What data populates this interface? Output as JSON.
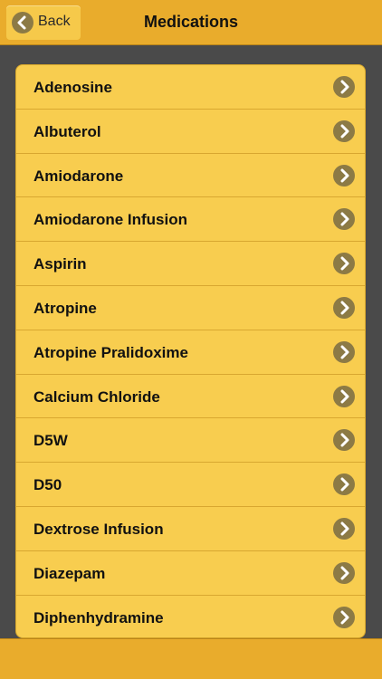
{
  "header": {
    "title": "Medications",
    "back_label": "Back"
  },
  "items": [
    {
      "label": "Adenosine"
    },
    {
      "label": "Albuterol"
    },
    {
      "label": "Amiodarone"
    },
    {
      "label": "Amiodarone Infusion"
    },
    {
      "label": "Aspirin"
    },
    {
      "label": "Atropine"
    },
    {
      "label": "Atropine Pralidoxime"
    },
    {
      "label": "Calcium Chloride"
    },
    {
      "label": "D5W"
    },
    {
      "label": "D50"
    },
    {
      "label": "Dextrose Infusion"
    },
    {
      "label": "Diazepam"
    },
    {
      "label": "Diphenhydramine"
    }
  ],
  "icons": {
    "back": "chevron-left-icon",
    "row": "chevron-right-icon"
  },
  "colors": {
    "bar": "#e9ac2c",
    "list": "#f8cd4f",
    "icon": "#8c7a45",
    "background": "#4a4a4a"
  }
}
